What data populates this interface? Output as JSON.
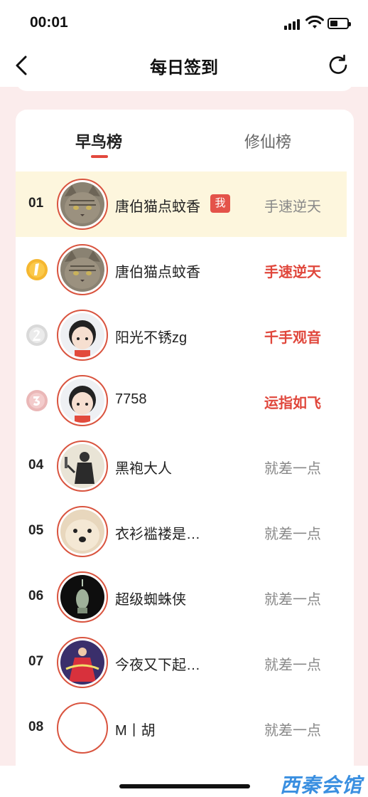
{
  "status_bar": {
    "time": "00:01",
    "battery_level": 0.45
  },
  "nav": {
    "title": "每日签到",
    "back_icon": "chevron-left-icon",
    "refresh_icon": "refresh-icon"
  },
  "tabs": [
    {
      "label": "早鸟榜",
      "active": true
    },
    {
      "label": "修仙榜",
      "active": false
    }
  ],
  "accent_color": "#e2483d",
  "rows": [
    {
      "rank": "01",
      "name": "唐伯猫点蚊香",
      "badge": "我",
      "status": "手速逆天",
      "mine": true,
      "medal": null,
      "avatar": "cat-avatar"
    },
    {
      "rank": "",
      "name": "唐伯猫点蚊香",
      "badge": "",
      "status": "手速逆天",
      "mine": false,
      "medal": "gold-medal-icon",
      "avatar": "cat-avatar"
    },
    {
      "rank": "",
      "name": "阳光不锈zg",
      "badge": "",
      "status": "千手观音",
      "mine": false,
      "medal": "silver-medal-icon",
      "avatar": "cartoon-avatar"
    },
    {
      "rank": "",
      "name": "7758",
      "badge": "",
      "status": "运指如飞",
      "mine": false,
      "medal": "bronze-medal-icon",
      "avatar": "cartoon-avatar"
    },
    {
      "rank": "04",
      "name": "黑袍大人",
      "badge": "",
      "status": "就差一点",
      "mine": false,
      "medal": null,
      "avatar": "ink-figure-avatar"
    },
    {
      "rank": "05",
      "name": "衣衫褴褛是…",
      "badge": "",
      "status": "就差一点",
      "mine": false,
      "medal": null,
      "avatar": "dog-avatar"
    },
    {
      "rank": "06",
      "name": "超级蜘蛛侠",
      "badge": "",
      "status": "就差一点",
      "mine": false,
      "medal": null,
      "avatar": "dark-avatar"
    },
    {
      "rank": "07",
      "name": "今夜又下起…",
      "badge": "",
      "status": "就差一点",
      "mine": false,
      "medal": null,
      "avatar": "dancer-avatar"
    },
    {
      "rank": "08",
      "name": "M丨胡",
      "badge": "",
      "status": "就差一点",
      "mine": false,
      "medal": null,
      "avatar": "blank-avatar"
    }
  ],
  "watermark": "西秦会馆"
}
